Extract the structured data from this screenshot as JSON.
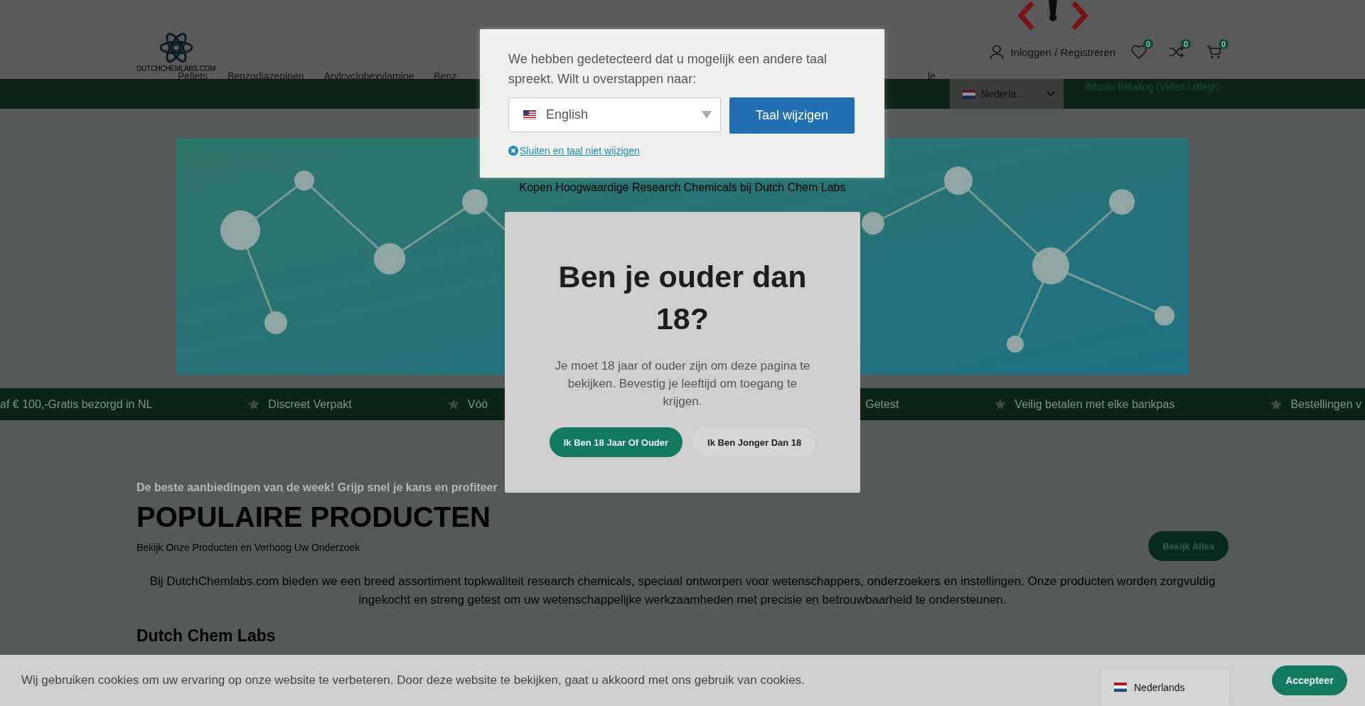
{
  "header": {
    "logo_text": "DUTCHCHEMLABS.COM",
    "account": "Inloggen / Registreren",
    "counters": [
      {
        "kind": "wishlist",
        "count": "0"
      },
      {
        "kind": "compare",
        "count": "0"
      },
      {
        "kind": "cart",
        "count": "0"
      }
    ]
  },
  "nav": {
    "items": [
      "Pellets",
      "Benzodiazepinen",
      "Arylcyclohexylamine",
      "Benz",
      "le"
    ],
    "language": "Nederla...",
    "promo": "Bitcoin Betaling (Video Uitleg!)"
  },
  "banner": {
    "heading": "Kopen Hoogwaardige Research Chemicals bij Dutch Chem Labs"
  },
  "ticker": [
    {
      "text": "af € 100,-Gratis bezorgd in NL",
      "star": false
    },
    {
      "text": "Discreet Verpakt",
      "star": true
    },
    {
      "text": "Vóó",
      "star": true
    },
    {
      "text": "Getest",
      "star": false
    },
    {
      "text": "Veilig betalen met elke bankpas",
      "star": true
    },
    {
      "text": "Bestellingen v",
      "star": true
    }
  ],
  "section": {
    "teaser": "De beste aanbiedingen van de week! Grijp snel je kans en profiteer",
    "title": "POPULAIRE PRODUCTEN",
    "subtitle": "Bekijk Onze Producten en Verhoog Uw Onderzoek",
    "button": "Bekijk Alles",
    "intro": "Bij DutchChemlabs.com bieden we een breed assortiment topkwaliteit research chemicals, speciaal ontworpen voor wetenschappers, onderzoekers en instellingen. Onze producten worden zorgvuldig ingekocht en streng getest om uw wetenschappelijke werkzaamheden met precisie en betrouwbaarheid te ondersteunen.",
    "heading": "Dutch Chem Labs"
  },
  "cookie_bar": {
    "text": "Wij gebruiken cookies om uw ervaring op onze website te verbeteren. Door deze website te bekijken, gaat u akkoord met ons gebruik van cookies.",
    "language": "Nederlands",
    "button": "Accepteer"
  },
  "language_popup": {
    "message": "We hebben gedetecteerd dat u mogelijk een andere taal spreekt. Wilt u overstappen naar:",
    "language": "English",
    "button": "Taal wijzigen",
    "dismiss": "Sluiten en taal niet wijzigen"
  },
  "age_gate": {
    "title": "Ben je ouder dan 18?",
    "message": "Je moet 18 jaar of ouder zijn om deze pagina te bekijken. Bevestig je leeftijd om toegang te krijgen.",
    "confirm": "Ik Ben 18 Jaar Of Ouder",
    "decline": "Ik Ben Jonger Dan 18"
  }
}
